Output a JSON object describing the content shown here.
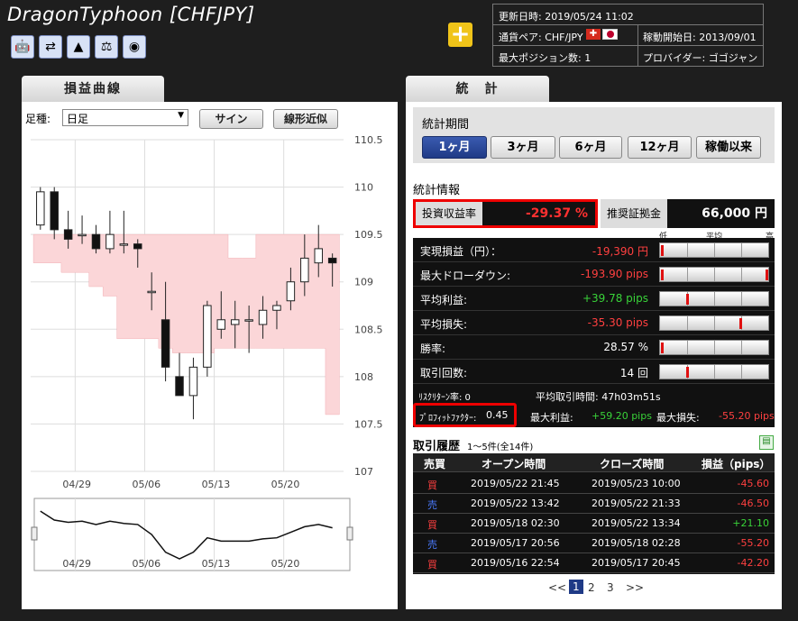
{
  "header": {
    "title": "DragonTyphoon [CHFJPY]",
    "plus_label": "+",
    "icons": [
      "robot-icon",
      "swap-icon",
      "tree-icon",
      "scale-icon",
      "disc-icon"
    ],
    "info": {
      "updated": "更新日時: 2019/05/24 11:02",
      "pair": "通貨ペア: CHF/JPY",
      "start": "稼動開始日: 2013/09/01",
      "maxpos": "最大ポジション数: 1",
      "provider": "プロバイダー: ゴゴジャン"
    }
  },
  "left": {
    "tab": "損益曲線",
    "foot_label": "足種:",
    "foot_value": "日足",
    "sign_btn": "サイン",
    "linear_btn": "線形近似"
  },
  "chart_data": {
    "type": "candlestick",
    "y_ticks": [
      "110.5",
      "110",
      "109.5",
      "109",
      "108.5",
      "108",
      "107.5",
      "107"
    ],
    "ylim": [
      107,
      110.5
    ],
    "x_ticks": [
      "04/29",
      "05/06",
      "05/13",
      "05/20"
    ],
    "candles": [
      {
        "o": 109.6,
        "h": 110.0,
        "l": 109.55,
        "c": 109.95
      },
      {
        "o": 109.95,
        "h": 110.0,
        "l": 109.45,
        "c": 109.55
      },
      {
        "o": 109.55,
        "h": 109.75,
        "l": 109.35,
        "c": 109.45
      },
      {
        "o": 109.5,
        "h": 109.7,
        "l": 109.4,
        "c": 109.5
      },
      {
        "o": 109.5,
        "h": 109.6,
        "l": 109.3,
        "c": 109.35
      },
      {
        "o": 109.35,
        "h": 109.75,
        "l": 109.3,
        "c": 109.5
      },
      {
        "o": 109.4,
        "h": 109.75,
        "l": 109.3,
        "c": 109.4
      },
      {
        "o": 109.4,
        "h": 109.45,
        "l": 109.15,
        "c": 109.35
      },
      {
        "o": 108.9,
        "h": 109.1,
        "l": 108.7,
        "c": 108.9
      },
      {
        "o": 108.6,
        "h": 109.0,
        "l": 107.95,
        "c": 108.1
      },
      {
        "o": 108.0,
        "h": 108.25,
        "l": 107.85,
        "c": 107.8
      },
      {
        "o": 107.8,
        "h": 108.2,
        "l": 107.55,
        "c": 108.1
      },
      {
        "o": 108.1,
        "h": 108.8,
        "l": 108.0,
        "c": 108.75
      },
      {
        "o": 108.5,
        "h": 108.9,
        "l": 108.4,
        "c": 108.6
      },
      {
        "o": 108.55,
        "h": 108.8,
        "l": 108.3,
        "c": 108.6
      },
      {
        "o": 108.6,
        "h": 108.75,
        "l": 108.25,
        "c": 108.6
      },
      {
        "o": 108.55,
        "h": 108.85,
        "l": 108.4,
        "c": 108.7
      },
      {
        "o": 108.7,
        "h": 108.8,
        "l": 108.5,
        "c": 108.75
      },
      {
        "o": 108.8,
        "h": 109.15,
        "l": 108.7,
        "c": 109.0
      },
      {
        "o": 109.0,
        "h": 109.5,
        "l": 108.85,
        "c": 109.25
      },
      {
        "o": 109.2,
        "h": 109.6,
        "l": 109.05,
        "c": 109.35
      },
      {
        "o": 109.25,
        "h": 109.3,
        "l": 108.95,
        "c": 109.2
      }
    ],
    "band_upper": [
      109.5,
      109.5,
      109.5,
      109.5,
      109.5,
      109.5,
      109.5,
      109.5,
      109.5,
      109.5,
      109.5,
      109.5,
      109.5,
      109.5,
      109.25,
      109.25,
      109.5,
      109.5,
      109.5,
      109.5,
      109.5,
      109.5
    ],
    "band_lower": [
      109.2,
      109.2,
      109.1,
      109.1,
      108.95,
      108.85,
      108.4,
      108.4,
      108.4,
      108.3,
      108.25,
      108.25,
      108.25,
      108.3,
      108.3,
      108.3,
      108.3,
      108.3,
      108.3,
      108.3,
      108.3,
      107.6
    ],
    "navigator_ticks": [
      "04/29",
      "05/06",
      "05/13",
      "05/20"
    ]
  },
  "right": {
    "tab": "統　計",
    "period_title": "統計期間",
    "periods": [
      "1ヶ月",
      "3ヶ月",
      "6ヶ月",
      "12ヶ月",
      "稼働以来"
    ],
    "stats_title": "統計情報",
    "roi_label": "投資収益率",
    "roi_value": "-29.37 %",
    "margin_label": "推奨証拠金",
    "margin_value": "66,000 円",
    "scale_labels": [
      "低",
      "平均",
      "高"
    ],
    "rows": [
      {
        "name": "実現損益（円）：",
        "value": "-19,390 円",
        "color": "red",
        "pos": 0.02
      },
      {
        "name": "最大ドローダウン:",
        "value": "-193.90 pips",
        "color": "red",
        "pos": 0.98,
        "pos2": 0.02
      },
      {
        "name": "平均利益:",
        "value": "+39.78 pips",
        "color": "green",
        "pos": 0.25
      },
      {
        "name": "平均損失:",
        "value": "-35.30 pips",
        "color": "red",
        "pos": 0.74
      },
      {
        "name": "勝率:",
        "value": "28.57 %",
        "color": "white",
        "pos": 0.02
      },
      {
        "name": "取引回数:",
        "value": "14 回",
        "color": "white",
        "pos": 0.25
      }
    ],
    "risk_return": "ﾘｽｸﾘﾀｰﾝ率: 0",
    "avg_time": "平均取引時間: 47h03m51s",
    "pf_label": "ﾌﾟﾛﾌｨｯﾄﾌｧｸﾀｰ:",
    "pf_value": "0.45",
    "max_profit_label": "最大利益:",
    "max_profit": "+59.20 pips",
    "max_loss_label": "最大損失:",
    "max_loss": "-55.20 pips",
    "history_title": "取引履歴",
    "history_sub": "1～5件(全14件)",
    "history_headers": [
      "売買",
      "オープン時間",
      "クローズ時間",
      "損益（pips）"
    ],
    "history": [
      {
        "side": "買",
        "open": "2019/05/22 21:45",
        "close": "2019/05/23 10:00",
        "pl": "-45.60",
        "sc": "red",
        "pc": "red"
      },
      {
        "side": "売",
        "open": "2019/05/22 13:42",
        "close": "2019/05/22 21:33",
        "pl": "-46.50",
        "sc": "blue",
        "pc": "red"
      },
      {
        "side": "買",
        "open": "2019/05/18 02:30",
        "close": "2019/05/22 13:34",
        "pl": "+21.10",
        "sc": "red",
        "pc": "green"
      },
      {
        "side": "売",
        "open": "2019/05/17 20:56",
        "close": "2019/05/18 02:28",
        "pl": "-55.20",
        "sc": "blue",
        "pc": "red"
      },
      {
        "side": "買",
        "open": "2019/05/16 22:54",
        "close": "2019/05/17 20:45",
        "pl": "-42.20",
        "sc": "red",
        "pc": "red"
      }
    ],
    "pager": {
      "prev": "<<",
      "pages": [
        "1",
        "2",
        "3"
      ],
      "next": ">>"
    }
  }
}
